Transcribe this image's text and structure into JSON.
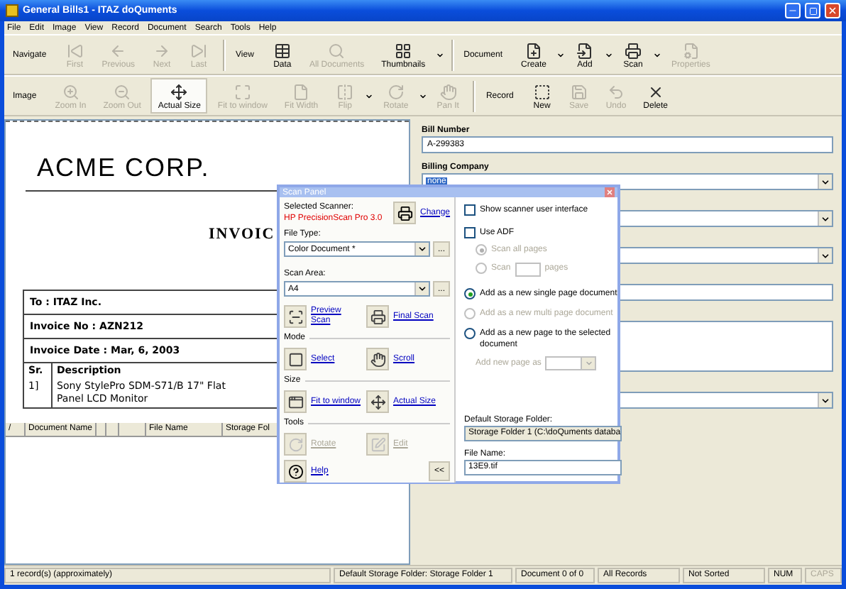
{
  "window": {
    "title": "General Bills1 - ITAZ doQuments"
  },
  "menu": [
    "File",
    "Edit",
    "Image",
    "View",
    "Record",
    "Document",
    "Search",
    "Tools",
    "Help"
  ],
  "toolbars": [
    {
      "groups": [
        {
          "label": "Navigate",
          "items": [
            {
              "kind": "button",
              "label": "First",
              "disabled": true,
              "pressed": false
            },
            {
              "kind": "button",
              "label": "Previous",
              "disabled": true,
              "pressed": false
            },
            {
              "kind": "button",
              "label": "Next",
              "disabled": true,
              "pressed": false
            },
            {
              "kind": "button",
              "label": "Last",
              "disabled": true,
              "pressed": false
            }
          ]
        },
        {
          "label": "View",
          "items": [
            {
              "kind": "button",
              "label": "Data",
              "disabled": false,
              "pressed": false
            },
            {
              "kind": "button",
              "label": "All Documents",
              "disabled": true,
              "pressed": false
            },
            {
              "kind": "button",
              "label": "Thumbnails",
              "disabled": false,
              "pressed": false
            },
            {
              "kind": "arrow"
            }
          ]
        },
        {
          "label": "Document",
          "items": [
            {
              "kind": "button",
              "label": "Create",
              "disabled": false,
              "pressed": false
            },
            {
              "kind": "arrow"
            },
            {
              "kind": "button",
              "label": "Add",
              "disabled": false,
              "pressed": false
            },
            {
              "kind": "arrow"
            },
            {
              "kind": "button",
              "label": "Scan",
              "disabled": false,
              "pressed": false
            },
            {
              "kind": "arrow"
            },
            {
              "kind": "button",
              "label": "Properties",
              "disabled": true,
              "pressed": false
            }
          ]
        }
      ]
    },
    {
      "groups": [
        {
          "label": "Image",
          "items": [
            {
              "kind": "button",
              "label": "Zoom In",
              "disabled": true,
              "pressed": false
            },
            {
              "kind": "button",
              "label": "Zoom Out",
              "disabled": true,
              "pressed": false
            },
            {
              "kind": "button",
              "label": "Actual Size",
              "disabled": false,
              "pressed": true
            },
            {
              "kind": "button",
              "label": "Fit to window",
              "disabled": true,
              "pressed": false
            },
            {
              "kind": "button",
              "label": "Fit Width",
              "disabled": true,
              "pressed": false
            },
            {
              "kind": "button",
              "label": "Flip",
              "disabled": true,
              "pressed": false
            },
            {
              "kind": "arrow"
            },
            {
              "kind": "button",
              "label": "Rotate",
              "disabled": true,
              "pressed": false
            },
            {
              "kind": "arrow"
            },
            {
              "kind": "button",
              "label": "Pan It",
              "disabled": true,
              "pressed": false
            }
          ]
        },
        {
          "label": "Record",
          "items": [
            {
              "kind": "button",
              "label": "New",
              "disabled": false,
              "pressed": false
            },
            {
              "kind": "button",
              "label": "Save",
              "disabled": true,
              "pressed": false
            },
            {
              "kind": "button",
              "label": "Undo",
              "disabled": true,
              "pressed": false
            },
            {
              "kind": "button",
              "label": "Delete",
              "disabled": false,
              "pressed": false
            }
          ]
        }
      ]
    }
  ],
  "document_image": {
    "company": "ACME CORP.",
    "heading": "INVOIC",
    "info_rows": [
      "To : ITAZ Inc.",
      "Invoice No : AZN212",
      "Invoice Date : Mar, 6, 2003"
    ],
    "columns": [
      "Sr.",
      "Description"
    ],
    "items": [
      {
        "sr": "1]",
        "description": [
          "Sony StylePro SDM-S71/B 17\" Flat",
          "Panel LCD Monitor"
        ]
      }
    ]
  },
  "document_list": {
    "columns": [
      "/",
      "Document Name",
      "",
      "",
      "",
      "File Name",
      "Storage Fol"
    ]
  },
  "form": {
    "fields": [
      {
        "kind": "text",
        "label": "Bill Number",
        "value": "A-299383",
        "text_selected": false
      },
      {
        "kind": "select",
        "label": "Billing Company",
        "value": "none",
        "text_selected": true
      },
      {
        "kind": "select"
      },
      {
        "kind": "select"
      },
      {
        "kind": "text"
      },
      {
        "kind": "textarea"
      },
      {
        "kind": "select"
      }
    ]
  },
  "scan_panel": {
    "title": "Scan Panel",
    "scanner_label": "Selected Scanner:",
    "scanner_name": "HP PrecisionScan Pro 3.0",
    "change": "Change",
    "file_type": {
      "label": "File Type:",
      "value": "Color Document *",
      "more": "..."
    },
    "scan_area": {
      "label": "Scan Area:",
      "value": "A4",
      "more": "..."
    },
    "groups": [
      {
        "actions": [
          {
            "label": "Preview Scan",
            "disabled": false
          },
          {
            "label": "Final Scan",
            "disabled": false
          }
        ]
      },
      {
        "label": "Mode",
        "actions": [
          {
            "label": "Select",
            "disabled": false
          },
          {
            "label": "Scroll",
            "disabled": false
          }
        ]
      },
      {
        "label": "Size",
        "actions": [
          {
            "label": "Fit to window",
            "disabled": false
          },
          {
            "label": "Actual Size",
            "disabled": false
          }
        ]
      },
      {
        "label": "Tools",
        "actions": [
          {
            "label": "Rotate",
            "disabled": true
          },
          {
            "label": "Edit",
            "disabled": true
          }
        ]
      }
    ],
    "help": "Help",
    "collapse": "<<",
    "checks": [
      {
        "label": "Show scanner user interface",
        "checked": false
      },
      {
        "label": "Use ADF",
        "checked": false
      }
    ],
    "adf_options": [
      {
        "kind": "all",
        "label": "Scan all pages",
        "selected": true,
        "disabled": true
      },
      {
        "kind": "count",
        "label": "Scan",
        "suffix": "pages",
        "selected": false,
        "disabled": true
      }
    ],
    "add_options": [
      {
        "label": "Add as a new single page document",
        "selected": true,
        "disabled": false
      },
      {
        "label": "Add as a new multi page document",
        "selected": false,
        "disabled": true
      },
      {
        "label": "Add as a new page to the selected document",
        "selected": false,
        "disabled": false
      }
    ],
    "add_new_page_as": {
      "label": "Add new page as",
      "disabled": true
    },
    "storage": {
      "label": "Default Storage Folder:",
      "value": "Storage Folder 1 (C:\\doQuments databa"
    },
    "file_name": {
      "label": "File Name:",
      "value": "13E9.tif"
    }
  },
  "status_bar": {
    "left": "1 record(s) (approximately)",
    "panes": [
      {
        "text": "Default Storage Folder: Storage Folder 1",
        "disabled": false
      },
      {
        "text": "Document 0 of 0",
        "disabled": false
      },
      {
        "text": "All Records",
        "disabled": false
      },
      {
        "text": "Not Sorted",
        "disabled": false
      },
      {
        "text": "NUM",
        "disabled": false
      },
      {
        "text": "CAPS",
        "disabled": true
      }
    ]
  }
}
